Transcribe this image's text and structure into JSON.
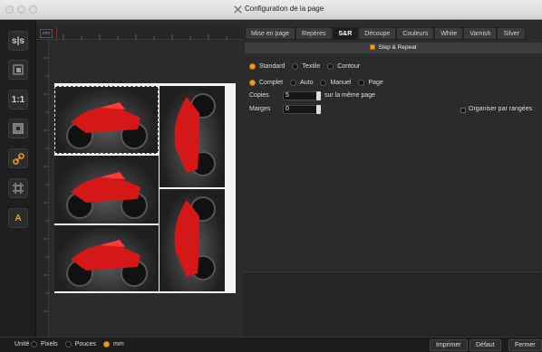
{
  "window": {
    "title": "Configuration de la page"
  },
  "toolbar": {
    "tools": [
      "s|s",
      "1:1",
      "A"
    ]
  },
  "ruler": {
    "unit": "mm"
  },
  "tabs": [
    "Mise en page",
    "Repères",
    "S&R",
    "Découpe",
    "Couleurs",
    "White",
    "Varnish",
    "Silver"
  ],
  "section": {
    "title": "Step & Repeat"
  },
  "mode": {
    "options": [
      "Standard",
      "Textile",
      "Contour"
    ],
    "selected": "Standard"
  },
  "fill": {
    "options": [
      "Complet",
      "Auto",
      "Manuel",
      "Page"
    ],
    "selected": "Complet"
  },
  "copies": {
    "label": "Copies",
    "value": "5",
    "suffix": "sur la même page"
  },
  "margins": {
    "label": "Marges",
    "value": "0"
  },
  "arrange": {
    "label": "Organiser par rangées"
  },
  "units": {
    "label": "Unité",
    "options": [
      "Pixels",
      "Pouces",
      "mm"
    ],
    "selected": "mm"
  },
  "buttons": {
    "print": "Imprimer",
    "default": "Défaut",
    "close": "Fermer"
  },
  "colors": {
    "accent": "#f0a020",
    "background": "#2a2a2a",
    "moto": "#d41818"
  }
}
